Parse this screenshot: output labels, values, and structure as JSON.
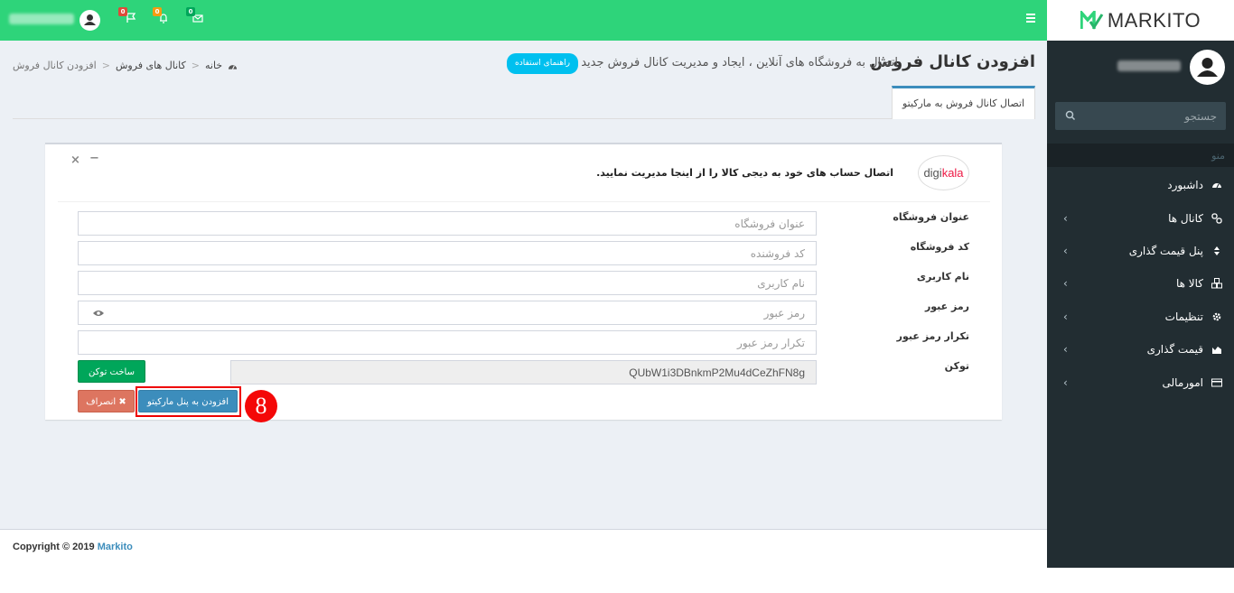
{
  "brand": {
    "name": "MARKITO"
  },
  "topbar": {
    "badges": {
      "messages": "0",
      "notifications": "0",
      "flags": "0"
    }
  },
  "sidebar": {
    "search_placeholder": "جستجو",
    "menu_header": "منو",
    "items": [
      {
        "label": "داشبورد",
        "icon": "dashboard-icon"
      },
      {
        "label": "کانال ها",
        "icon": "link-icon"
      },
      {
        "label": "پنل قیمت گذاری",
        "icon": "sort-icon"
      },
      {
        "label": "کالا ها",
        "icon": "cubes-icon"
      },
      {
        "label": "تنظیمات",
        "icon": "gear-icon"
      },
      {
        "label": "قیمت گذاری",
        "icon": "area-chart-icon"
      },
      {
        "label": "امورمالی",
        "icon": "credit-card-icon"
      }
    ]
  },
  "header": {
    "title": "افزودن کانال فروش",
    "subtitle": "اتصال به فروشگاه های آنلاین ، ایجاد و مدیریت کانال فروش جدید",
    "guide_button": "راهنمای استفاده",
    "breadcrumb": {
      "home": "خانه",
      "channels": "کانال های فروش",
      "current": "افزودن کانال فروش",
      "sep": ">"
    }
  },
  "tab": {
    "label": "اتصال کانال فروش به مارکیتو"
  },
  "box": {
    "logo_left": "digi",
    "logo_right": "kala",
    "description": "اتصال حساب های خود به دیجی کالا را از اینجا مدیریت نمایید.",
    "tool_minus": "−",
    "tool_close": "×"
  },
  "form": {
    "fields": [
      {
        "label": "عنوان فروشگاه",
        "placeholder": "عنوان فروشگاه"
      },
      {
        "label": "کد فروشگاه",
        "placeholder": "کد فروشنده"
      },
      {
        "label": "نام کاربری",
        "placeholder": "نام کاربری"
      },
      {
        "label": "رمز عبور",
        "placeholder": "رمز عبور"
      },
      {
        "label": "تکرار رمز عبور",
        "placeholder": "تکرار رمز عبور"
      },
      {
        "label": "توکن",
        "value": "QUbW1i3DBnkmP2Mu4dCeZhFN8g"
      }
    ],
    "token_button": "ساخت توکن",
    "cancel_button": "انصراف",
    "submit_button": "افزودن به پنل مارکیتو",
    "step_number": "8"
  },
  "footer": {
    "prefix": "Copyright © 2019",
    "brand": "Markito"
  }
}
